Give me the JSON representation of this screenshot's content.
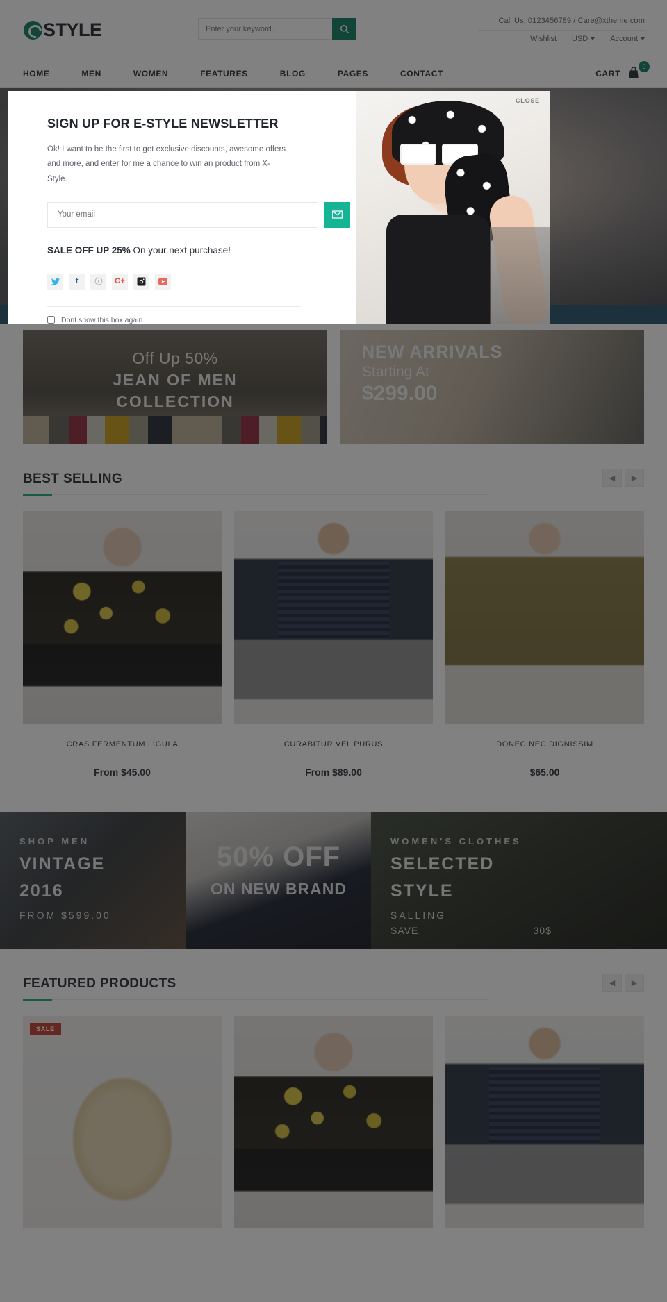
{
  "header": {
    "logo_text": "STYLE",
    "logo_icon": "e-circle-logo",
    "search_placeholder": "Enter your keyword...",
    "search_value": "",
    "search_icon": "search-icon",
    "call_us": "Call Us: 0123456789 / Care@xtheme.com",
    "utils": [
      {
        "label": "Wishlist",
        "caret": false
      },
      {
        "label": "USD",
        "caret": true
      },
      {
        "label": "Account",
        "caret": true
      }
    ]
  },
  "nav": {
    "items": [
      "HOME",
      "MEN",
      "WOMEN",
      "FEATURES",
      "BLOG",
      "PAGES",
      "CONTACT"
    ],
    "cart_label": "CART",
    "cart_icon": "shopping-bag-icon",
    "cart_count": "0"
  },
  "promos": {
    "jean": {
      "line1": "Off Up 50%",
      "line2": "JEAN OF MEN",
      "line3": "COLLECTION"
    },
    "new": {
      "line1": "NEW ARRIVALS",
      "line2": "Starting At",
      "line3": "$299.00"
    }
  },
  "best_selling": {
    "title": "BEST SELLING",
    "prev_icon": "chevron-left-icon",
    "next_icon": "chevron-right-icon",
    "products": [
      {
        "name": "CRAS FERMENTUM LIGULA",
        "price": "From $45.00"
      },
      {
        "name": "CURABITUR VEL PURUS",
        "price": "From $89.00"
      },
      {
        "name": "DONEC NEC DIGNISSIM",
        "price": "$65.00"
      }
    ]
  },
  "banners": [
    {
      "kicker": "SHOP MEN",
      "head1": "VINTAGE",
      "head2": "2016",
      "sub": "FROM $599.00"
    },
    {
      "big": "50% OFF",
      "small": "ON NEW BRAND"
    },
    {
      "kicker": "WOMEN'S CLOTHES",
      "head1": "SELECTED",
      "head2": "STYLE",
      "sub1": "SALLING",
      "sub2": "SAVE",
      "sub3": "30$"
    }
  ],
  "featured": {
    "title": "FEATURED PRODUCTS",
    "prev_icon": "chevron-left-icon",
    "next_icon": "chevron-right-icon",
    "sale_badge": "SALE"
  },
  "modal": {
    "close_label": "CLOSE",
    "title": "SIGN UP FOR E-STYLE NEWSLETTER",
    "description": "Ok! I want to be the first to get exclusive discounts, awesome offers and more, and enter for me a chance to win an product from X-Style.",
    "email_placeholder": "Your email",
    "email_value": "",
    "submit_icon": "envelope-icon",
    "sale_bold": "SALE OFF UP 25%",
    "sale_rest": " On your next purchase!",
    "socials": [
      {
        "name": "twitter",
        "glyph": "🐦"
      },
      {
        "name": "facebook",
        "glyph": "f"
      },
      {
        "name": "pinterest",
        "glyph": "Ⓟ"
      },
      {
        "name": "google-plus",
        "glyph": "G+"
      },
      {
        "name": "instagram",
        "glyph": "▣"
      },
      {
        "name": "youtube",
        "glyph": "▶"
      }
    ],
    "checkbox_label": "Dont show this box again",
    "checkbox_checked": false
  },
  "colors": {
    "accent_green": "#0b7a5c",
    "teal": "#14b494",
    "underline_green": "#19a97e",
    "sale_red": "#c0392b",
    "text_dark": "#22272f"
  }
}
